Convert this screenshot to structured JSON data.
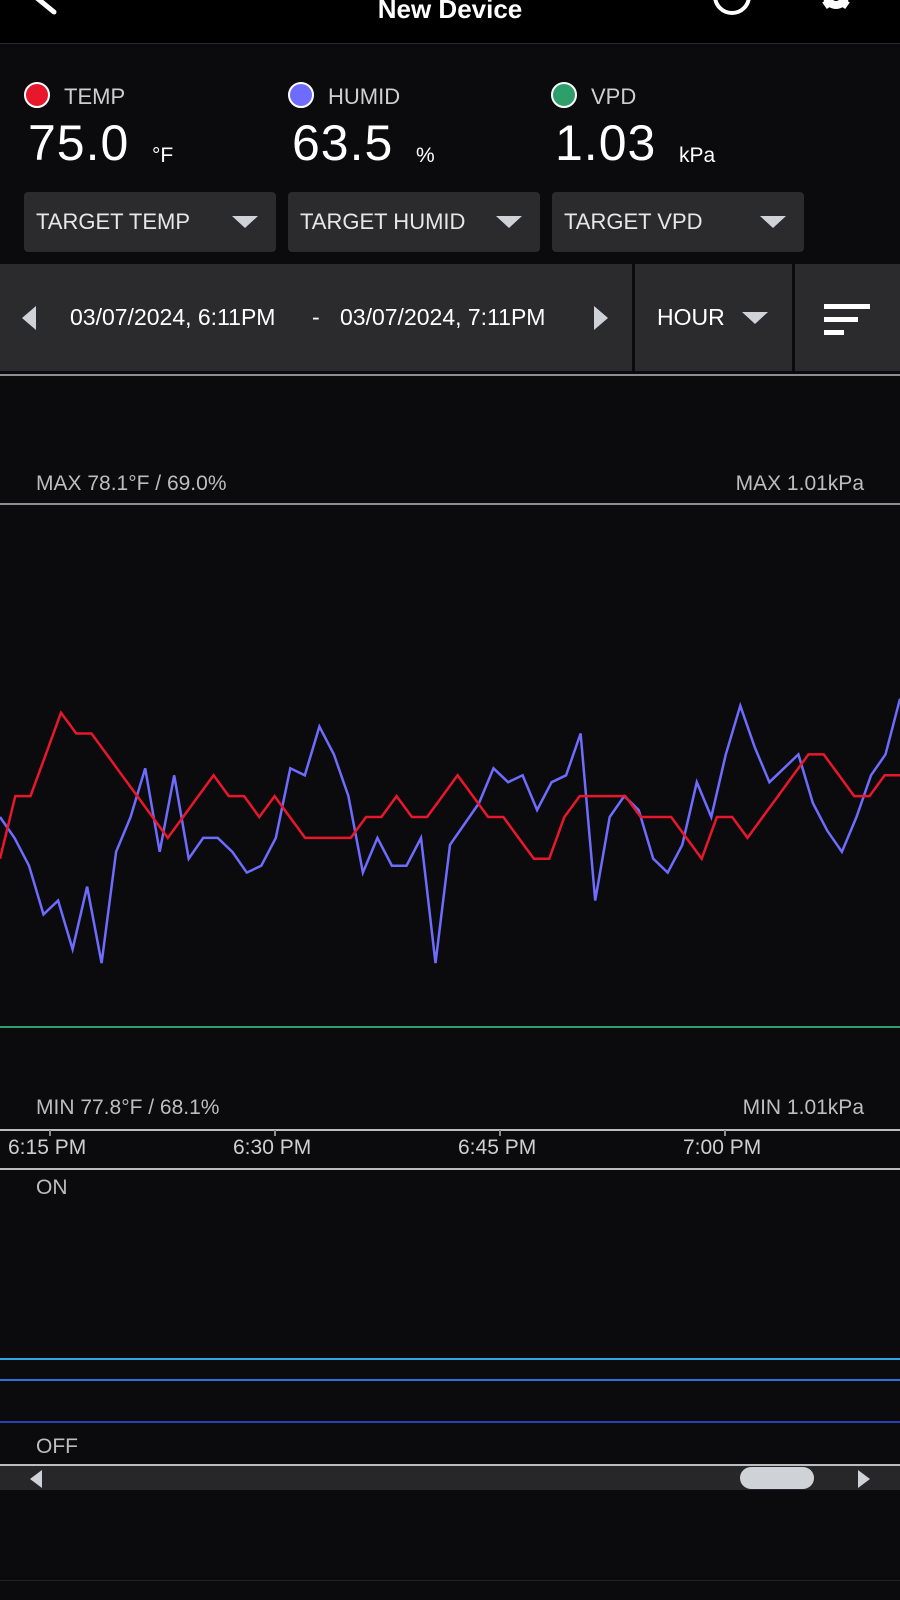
{
  "header": {
    "title": "New Device",
    "icons": {
      "back": "back-arrow-icon",
      "info": "info-icon",
      "settings": "gear-icon"
    }
  },
  "readings": [
    {
      "label": "TEMP",
      "value": "75.0",
      "unit": "°F",
      "color": "#e8172c"
    },
    {
      "label": "HUMID",
      "value": "63.5",
      "unit": "%",
      "color": "#6e6cff"
    },
    {
      "label": "VPD",
      "value": "1.03",
      "unit": "kPa",
      "color": "#2e9e6b"
    }
  ],
  "targets": [
    {
      "label": "TARGET TEMP"
    },
    {
      "label": "TARGET HUMID"
    },
    {
      "label": "TARGET VPD"
    }
  ],
  "range": {
    "start": "03/07/2024, 6:11PM",
    "separator": "-",
    "end": "03/07/2024, 7:11PM",
    "interval": "HOUR"
  },
  "chart_labels": {
    "max_left": "MAX 78.1°F / 69.0%",
    "max_right": "MAX 1.01kPa",
    "min_left": "MIN 77.8°F / 68.1%",
    "min_right": "MIN 1.01kPa",
    "on": "ON",
    "off": "OFF"
  },
  "chart_data": {
    "type": "line",
    "x_ticks": [
      "6:15 PM",
      "6:30 PM",
      "6:45 PM",
      "7:00 PM"
    ],
    "x_range": [
      "6:11 PM",
      "7:11 PM"
    ],
    "series": [
      {
        "name": "TEMP",
        "color": "#e8172c",
        "values": [
          77.93,
          77.96,
          77.96,
          77.98,
          78.0,
          77.99,
          77.99,
          77.98,
          77.97,
          77.96,
          77.95,
          77.94,
          77.95,
          77.96,
          77.97,
          77.96,
          77.96,
          77.95,
          77.96,
          77.95,
          77.94,
          77.94,
          77.94,
          77.94,
          77.95,
          77.95,
          77.96,
          77.95,
          77.95,
          77.96,
          77.97,
          77.96,
          77.95,
          77.95,
          77.94,
          77.93,
          77.93,
          77.95,
          77.96,
          77.96,
          77.96,
          77.96,
          77.95,
          77.95,
          77.95,
          77.94,
          77.93,
          77.95,
          77.95,
          77.94,
          77.95,
          77.96,
          77.97,
          77.98,
          77.98,
          77.97,
          77.96,
          77.96,
          77.97,
          77.97
        ]
      },
      {
        "name": "HUMID",
        "color": "#6e6cff",
        "values": [
          68.55,
          68.52,
          68.48,
          68.41,
          68.43,
          68.36,
          68.45,
          68.34,
          68.5,
          68.55,
          68.62,
          68.5,
          68.61,
          68.49,
          68.52,
          68.52,
          68.5,
          68.47,
          68.48,
          68.52,
          68.62,
          68.61,
          68.68,
          68.64,
          68.58,
          68.47,
          68.52,
          68.48,
          68.48,
          68.52,
          68.34,
          68.51,
          68.54,
          68.57,
          68.62,
          68.6,
          68.61,
          68.56,
          68.6,
          68.61,
          68.67,
          68.43,
          68.55,
          68.58,
          68.56,
          68.49,
          68.47,
          68.51,
          68.6,
          68.55,
          68.64,
          68.71,
          68.65,
          68.6,
          68.62,
          68.64,
          68.57,
          68.53,
          68.5,
          68.55,
          68.61,
          68.64,
          68.72
        ]
      }
    ],
    "y_range_left": [
      "77.8°F / 68.1%",
      "78.1°F / 69.0%"
    ],
    "vpd_line": "1.01kPa",
    "state_lines": [
      {
        "color": "#2fa6e8"
      },
      {
        "color": "#2c6fd8"
      },
      {
        "color": "#2a3fb8"
      }
    ]
  }
}
